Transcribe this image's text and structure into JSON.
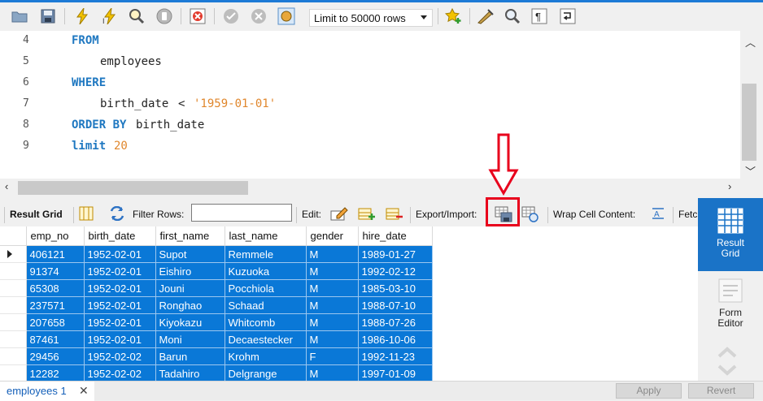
{
  "toolbar": {
    "limit_label": "Limit to 50000 rows",
    "icons": [
      "open-folder-icon",
      "save-icon",
      "execute-icon",
      "execute-current-icon",
      "explain-icon",
      "stop-icon",
      "toggle-error-icon",
      "commit-icon",
      "rollback-icon",
      "autocommit-icon",
      "limit-dropdown",
      "beautify-icon",
      "find-icon",
      "invisible-chars-icon",
      "wrap-icon"
    ]
  },
  "editor": {
    "lines": [
      {
        "num": "4",
        "text": "FROM"
      },
      {
        "num": "5",
        "text": "employees"
      },
      {
        "num": "6",
        "text": "WHERE"
      },
      {
        "num": "7",
        "col": "birth_date",
        "op": "<",
        "str": "'1959-01-01'"
      },
      {
        "num": "8",
        "kw": "ORDER BY",
        "col": "birth_date"
      },
      {
        "num": "9",
        "kw": "limit",
        "num_val": "20"
      }
    ]
  },
  "result_toolbar": {
    "result_grid": "Result Grid",
    "filter_rows": "Filter Rows:",
    "edit": "Edit:",
    "export_import": "Export/Import:",
    "wrap_cell": "Wrap Cell Content:",
    "fetch": "Fetc"
  },
  "grid": {
    "columns": [
      "emp_no",
      "birth_date",
      "first_name",
      "last_name",
      "gender",
      "hire_date"
    ],
    "rows": [
      [
        "406121",
        "1952-02-01",
        "Supot",
        "Remmele",
        "M",
        "1989-01-27"
      ],
      [
        "91374",
        "1952-02-01",
        "Eishiro",
        "Kuzuoka",
        "M",
        "1992-02-12"
      ],
      [
        "65308",
        "1952-02-01",
        "Jouni",
        "Pocchiola",
        "M",
        "1985-03-10"
      ],
      [
        "237571",
        "1952-02-01",
        "Ronghao",
        "Schaad",
        "M",
        "1988-07-10"
      ],
      [
        "207658",
        "1952-02-01",
        "Kiyokazu",
        "Whitcomb",
        "M",
        "1988-07-26"
      ],
      [
        "87461",
        "1952-02-01",
        "Moni",
        "Decaestecker",
        "M",
        "1986-10-06"
      ],
      [
        "29456",
        "1952-02-02",
        "Barun",
        "Krohm",
        "F",
        "1992-11-23"
      ],
      [
        "12282",
        "1952-02-02",
        "Tadahiro",
        "Delgrange",
        "M",
        "1997-01-09"
      ]
    ]
  },
  "side_panel": {
    "result_grid_line1": "Result",
    "result_grid_line2": "Grid",
    "form_editor_line1": "Form",
    "form_editor_line2": "Editor"
  },
  "bottom": {
    "tab_label": "employees 1",
    "tab_close": "✕",
    "apply": "Apply",
    "revert": "Revert"
  },
  "colors": {
    "selection": "#0a78d7",
    "keyword": "#1f78c1",
    "string": "#e0872d",
    "highlight": "#e8001c"
  }
}
